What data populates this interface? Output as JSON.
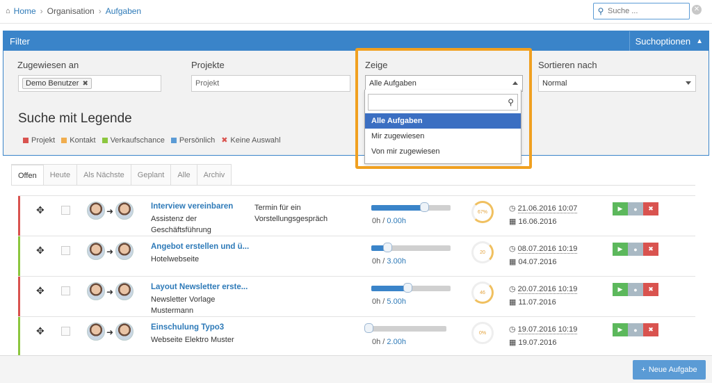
{
  "breadcrumb": {
    "home": "Home",
    "org": "Organisation",
    "current": "Aufgaben"
  },
  "search": {
    "placeholder": "Suche ..."
  },
  "filter": {
    "title": "Filter",
    "search_options": "Suchoptionen",
    "assigned_label": "Zugewiesen an",
    "assigned_tag": "Demo Benutzer",
    "projects_label": "Projekte",
    "projects_placeholder": "Projekt",
    "show_label": "Zeige",
    "show_value": "Alle Aufgaben",
    "sort_label": "Sortieren nach",
    "sort_value": "Normal",
    "legend_title": "Suche mit Legende",
    "legend": [
      {
        "label": "Projekt",
        "color": "#d9534f"
      },
      {
        "label": "Kontakt",
        "color": "#f0ad4e"
      },
      {
        "label": "Verkaufschance",
        "color": "#8cc63f"
      },
      {
        "label": "Persönlich",
        "color": "#5b9bd5"
      },
      {
        "label": "Keine Auswahl",
        "color": "#d9534f"
      }
    ]
  },
  "dropdown": {
    "options": [
      "Alle Aufgaben",
      "Mir zugewiesen",
      "Von mir zugewiesen"
    ],
    "selected": "Alle Aufgaben"
  },
  "tabs": [
    "Offen",
    "Heute",
    "Als Nächste",
    "Geplant",
    "Alle",
    "Archiv"
  ],
  "active_tab": "Offen",
  "tasks": [
    {
      "title": "Interview vereinbaren",
      "sub": "Assistenz der Geschäftsführung",
      "desc": "Termin für ein Vorstellungsgespräch",
      "hours": "0h",
      "planned": "0.00h",
      "progress": 0.67,
      "percent_label": "67%",
      "due": "21.06.2016 10:07",
      "created": "16.06.2016",
      "color": "#d9534f"
    },
    {
      "title": "Angebot erstellen und ü...",
      "sub": "Hotelwebseite",
      "desc": "",
      "hours": "0h",
      "planned": "3.00h",
      "progress": 0.2,
      "percent_label": "20",
      "due": "08.07.2016 10:19",
      "created": "04.07.2016",
      "color": "#8cc63f"
    },
    {
      "title": "Layout Newsletter erste...",
      "sub": "Newsletter Vorlage Mustermann",
      "desc": "",
      "hours": "0h",
      "planned": "5.00h",
      "progress": 0.46,
      "percent_label": "46",
      "due": "20.07.2016 10:19",
      "created": "11.07.2016",
      "color": "#d9534f"
    },
    {
      "title": "Einschulung Typo3",
      "sub": "Webseite Elektro Muster",
      "desc": "",
      "hours": "0h",
      "planned": "2.00h",
      "progress": 0.0,
      "percent_label": "0%",
      "due": "19.07.2016 10:19",
      "created": "19.07.2016",
      "color": "#8cc63f"
    }
  ],
  "new_task_button": "Neue Aufgabe"
}
